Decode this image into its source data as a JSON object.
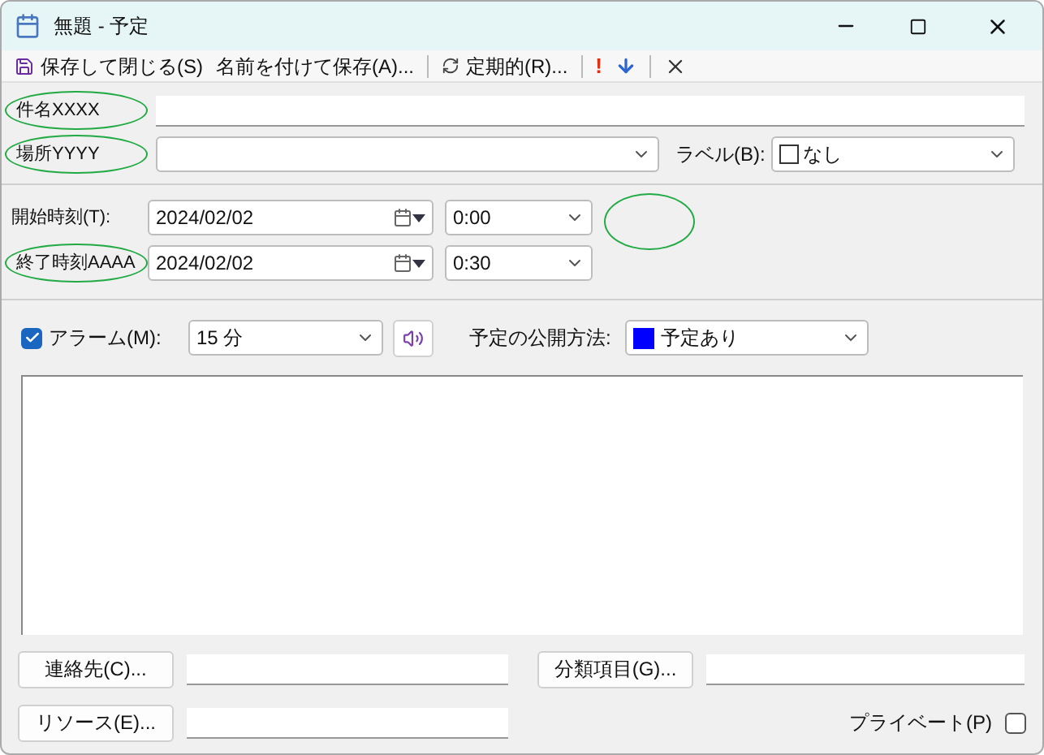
{
  "window": {
    "title": "無題 - 予定"
  },
  "toolbar": [
    {
      "kind": "save",
      "label": "保存して閉じる(S)"
    },
    {
      "kind": "text",
      "label": "名前を付けて保存(A)..."
    },
    {
      "kind": "sep"
    },
    {
      "kind": "recur",
      "label": "定期的(R)..."
    },
    {
      "kind": "sep"
    },
    {
      "kind": "important",
      "label": "!"
    },
    {
      "kind": "low"
    },
    {
      "kind": "sep"
    },
    {
      "kind": "delete"
    }
  ],
  "subject": {
    "label": "件名XXXX",
    "circled": true
  },
  "location": {
    "label": "場所YYYY",
    "circled": true
  },
  "label_field": {
    "label": "ラベル(B):",
    "value": "なし"
  },
  "start": {
    "label": "開始時刻(T):",
    "circled": false,
    "date": "2024/02/02",
    "time": "0:00"
  },
  "end": {
    "label": "終了時刻AAAA",
    "circled": true,
    "date": "2024/02/02",
    "time": "0:30"
  },
  "alarm": {
    "label": "アラーム(M):",
    "checked": true,
    "value": "15 分"
  },
  "show_as": {
    "label": "予定の公開方法:",
    "value": "予定あり",
    "color": "#0000ff"
  },
  "contacts_button": "連絡先(C)...",
  "categories_button": "分類項目(G)...",
  "resources_button": "リソース(E)...",
  "private": {
    "label": "プライベート(P)",
    "checked": false
  }
}
